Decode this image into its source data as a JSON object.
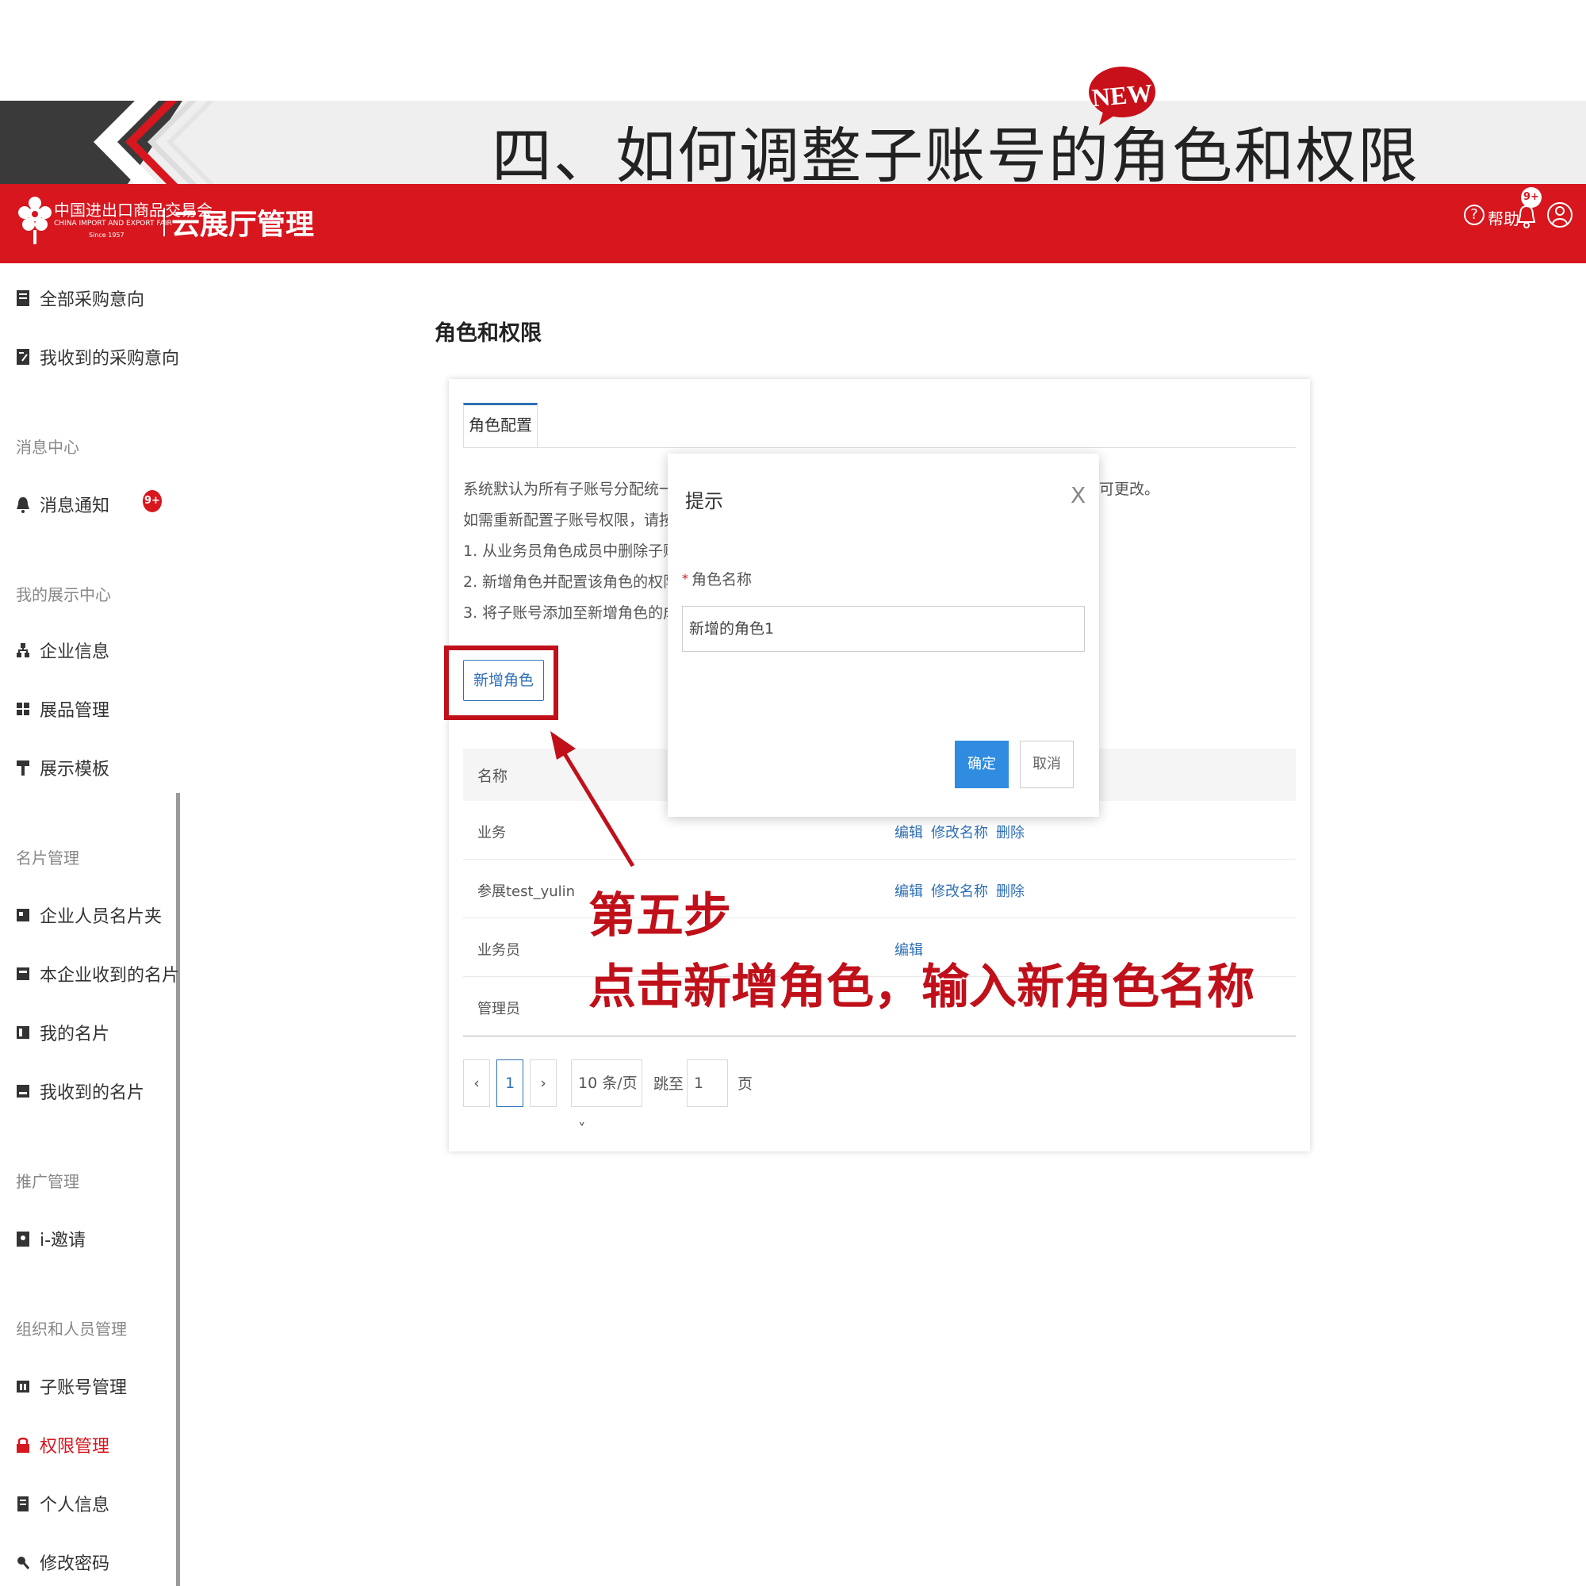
{
  "banner": {
    "title": "四、如何调整子账号的角色和权限",
    "badge": "NEW"
  },
  "header": {
    "logo_cn": "中国进出口商品交易会",
    "logo_en": "CHINA IMPORT AND EXPORT FAIR",
    "logo_since": "Since 1957",
    "app_name": "云展厅管理",
    "help_label": "帮助",
    "notif_badge": "9+"
  },
  "sidebar": {
    "items": [
      {
        "label": "全部采购意向"
      },
      {
        "label": "我收到的采购意向"
      },
      {
        "label": "消息通知"
      },
      {
        "label": "企业信息"
      },
      {
        "label": "展品管理"
      },
      {
        "label": "展示模板"
      },
      {
        "label": "企业人员名片夹"
      },
      {
        "label": "本企业收到的名片"
      },
      {
        "label": "我的名片"
      },
      {
        "label": "我收到的名片"
      },
      {
        "label": "i-邀请"
      },
      {
        "label": "子账号管理"
      },
      {
        "label": "权限管理"
      },
      {
        "label": "个人信息"
      },
      {
        "label": "修改密码"
      }
    ],
    "groups": [
      "消息中心",
      "我的展示中心",
      "名片管理",
      "推广管理",
      "组织和人员管理"
    ],
    "message_badge": "9+",
    "active_color": "#d7161e"
  },
  "main": {
    "page_title": "角色和权限",
    "tab_label": "角色配置",
    "description": [
      "系统默认为所有子账号分配统一的业务员",
      "如需重新配置子账号权限，请按以下步骤",
      "1. 从业务员角色成员中删除子账号",
      "2. 新增角色并配置该角色的权限",
      "3. 将子账号添加至新增角色的成员"
    ],
    "description_tail": "可更改。",
    "add_role_button": "新增角色",
    "table": {
      "header_name": "名称",
      "rows": [
        {
          "name": "业务",
          "actions": [
            "编辑",
            "修改名称",
            "删除"
          ]
        },
        {
          "name": "参展test_yulin",
          "actions": [
            "编辑",
            "修改名称",
            "删除"
          ]
        },
        {
          "name": "业务员",
          "actions": [
            "编辑"
          ]
        },
        {
          "name": "管理员",
          "actions": []
        }
      ]
    },
    "pager": {
      "prev": "‹",
      "current": "1",
      "next": "›",
      "page_size": "10 条/页 ˅",
      "jump_label": "跳至",
      "jump_value": "1",
      "page_suffix": "页"
    }
  },
  "dialog": {
    "title": "提示",
    "close": "X",
    "required_mark": "*",
    "field_label": "角色名称",
    "field_value": "新增的角色1",
    "ok": "确定",
    "cancel": "取消"
  },
  "annotation": {
    "step": "第五步",
    "text": "点击新增角色，输入新角色名称",
    "color": "#c0101a"
  }
}
